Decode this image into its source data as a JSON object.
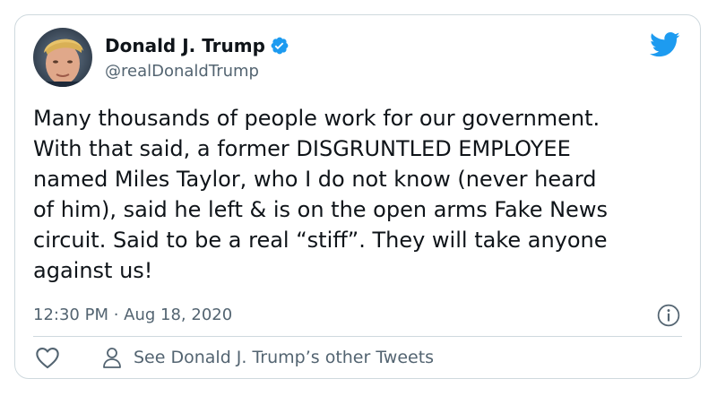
{
  "tweet": {
    "author_name": "Donald J. Trump",
    "author_handle": "@realDonaldTrump",
    "text": "Many thousands of people work for our government.\nWith that said, a former DISGRUNTLED EMPLOYEE\nnamed Miles Taylor, who I do not know (never heard\nof him), said he left & is on the open arms Fake News\ncircuit. Said to be a real “stiff”. They will take anyone\nagainst us!",
    "timestamp": "12:30 PM · Aug 18, 2020"
  },
  "actions": {
    "other_tweets_label": "See Donald J. Trump’s other Tweets"
  },
  "icons": {
    "verified": "verified-badge-icon",
    "brand": "twitter-bird-icon",
    "info": "info-icon",
    "like": "heart-icon",
    "profile": "person-icon"
  },
  "colors": {
    "brand_blue": "#1d9bf0",
    "text_primary": "#0f1419",
    "text_secondary": "#536471",
    "border": "#cfd9de"
  }
}
